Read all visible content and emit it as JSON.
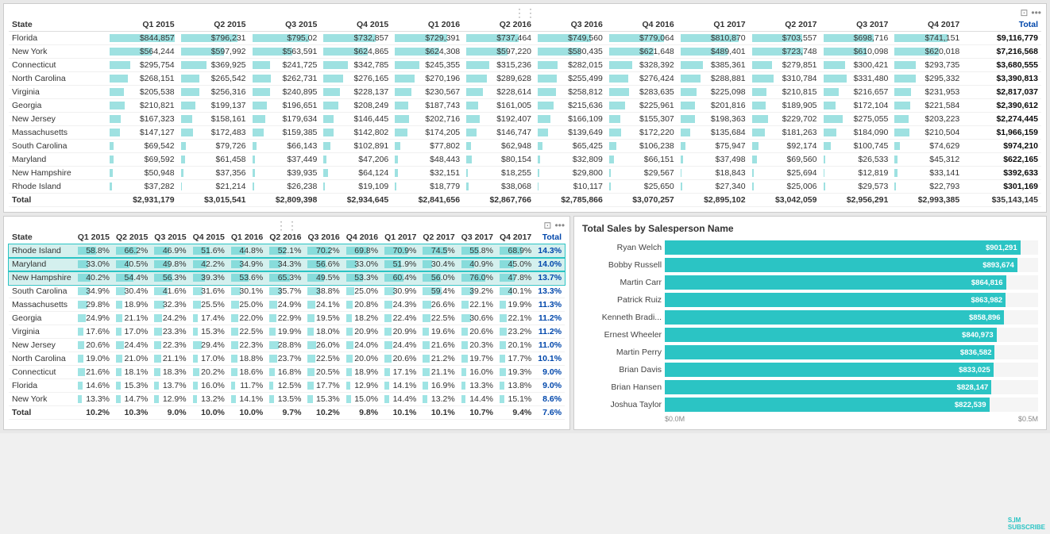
{
  "topTable": {
    "title": "State",
    "columns": [
      "State",
      "Q1 2015",
      "Q2 2015",
      "Q3 2015",
      "Q4 2015",
      "Q1 2016",
      "Q2 2016",
      "Q3 2016",
      "Q4 2016",
      "Q1 2017",
      "Q2 2017",
      "Q3 2017",
      "Q4 2017",
      "Total"
    ],
    "rows": [
      [
        "Florida",
        "$844,857",
        "$796,231",
        "$795,02",
        "$732,857",
        "$729,391",
        "$737,464",
        "$749,560",
        "$779,064",
        "$810,870",
        "$703,557",
        "$698,716",
        "$741,151",
        "$9,116,779"
      ],
      [
        "New York",
        "$564,244",
        "$597,992",
        "$563,591",
        "$624,865",
        "$624,308",
        "$597,220",
        "$580,435",
        "$621,648",
        "$489,401",
        "$723,748",
        "$610,098",
        "$620,018",
        "$7,216,568"
      ],
      [
        "Connecticut",
        "$295,754",
        "$369,925",
        "$241,725",
        "$342,785",
        "$245,355",
        "$315,236",
        "$282,015",
        "$328,392",
        "$385,361",
        "$279,851",
        "$300,421",
        "$293,735",
        "$3,680,555"
      ],
      [
        "North Carolina",
        "$268,151",
        "$265,542",
        "$262,731",
        "$276,165",
        "$270,196",
        "$289,628",
        "$255,499",
        "$276,424",
        "$288,881",
        "$310,784",
        "$331,480",
        "$295,332",
        "$3,390,813"
      ],
      [
        "Virginia",
        "$205,538",
        "$256,316",
        "$240,895",
        "$228,137",
        "$230,567",
        "$228,614",
        "$258,812",
        "$283,635",
        "$225,098",
        "$210,815",
        "$216,657",
        "$231,953",
        "$2,817,037"
      ],
      [
        "Georgia",
        "$210,821",
        "$199,137",
        "$196,651",
        "$208,249",
        "$187,743",
        "$161,005",
        "$215,636",
        "$225,961",
        "$201,816",
        "$189,905",
        "$172,104",
        "$221,584",
        "$2,390,612"
      ],
      [
        "New Jersey",
        "$167,323",
        "$158,161",
        "$179,634",
        "$146,445",
        "$202,716",
        "$192,407",
        "$166,109",
        "$155,307",
        "$198,363",
        "$229,702",
        "$275,055",
        "$203,223",
        "$2,274,445"
      ],
      [
        "Massachusetts",
        "$147,127",
        "$172,483",
        "$159,385",
        "$142,802",
        "$174,205",
        "$146,747",
        "$139,649",
        "$172,220",
        "$135,684",
        "$181,263",
        "$184,090",
        "$210,504",
        "$1,966,159"
      ],
      [
        "South Carolina",
        "$69,542",
        "$79,726",
        "$66,143",
        "$102,891",
        "$77,802",
        "$62,948",
        "$65,425",
        "$106,238",
        "$75,947",
        "$92,174",
        "$100,745",
        "$74,629",
        "$974,210"
      ],
      [
        "Maryland",
        "$69,592",
        "$61,458",
        "$37,449",
        "$47,206",
        "$48,443",
        "$80,154",
        "$32,809",
        "$66,151",
        "$37,498",
        "$69,560",
        "$26,533",
        "$45,312",
        "$622,165"
      ],
      [
        "New Hampshire",
        "$50,948",
        "$37,356",
        "$39,935",
        "$64,124",
        "$32,151",
        "$18,255",
        "$29,800",
        "$29,567",
        "$18,843",
        "$25,694",
        "$12,819",
        "$33,141",
        "$392,633"
      ],
      [
        "Rhode Island",
        "$37,282",
        "$21,214",
        "$26,238",
        "$19,109",
        "$18,779",
        "$38,068",
        "$10,117",
        "$25,650",
        "$27,340",
        "$25,006",
        "$29,573",
        "$22,793",
        "$301,169"
      ],
      [
        "Total",
        "$2,931,179",
        "$3,015,541",
        "$2,809,398",
        "$2,934,645",
        "$2,841,656",
        "$2,867,766",
        "$2,785,866",
        "$3,070,257",
        "$2,895,102",
        "$3,042,059",
        "$2,956,291",
        "$2,993,385",
        "$35,143,145"
      ]
    ],
    "barWidths": [
      100,
      87,
      87,
      80,
      80,
      81,
      82,
      85,
      89,
      77,
      77,
      81,
      0,
      65,
      66,
      62,
      68,
      68,
      63,
      66,
      68,
      72,
      79,
      67,
      68,
      0,
      32,
      40,
      27,
      38,
      27,
      35,
      31,
      36,
      27,
      31,
      33,
      32,
      0,
      29,
      28,
      29,
      30,
      30,
      32,
      29,
      30,
      28,
      34,
      36,
      32,
      0,
      22,
      28,
      27,
      25,
      25,
      25,
      28,
      31,
      25,
      23,
      24,
      25,
      0,
      23,
      22,
      13,
      17,
      17,
      21,
      9,
      22,
      14,
      21,
      10,
      17,
      0,
      18,
      15,
      14,
      15,
      19,
      18,
      15,
      16,
      12,
      17,
      17,
      15,
      0,
      7,
      8,
      7,
      11,
      8,
      7,
      7,
      11,
      8,
      10,
      11,
      8,
      0,
      7,
      6,
      4,
      5,
      5,
      9,
      4,
      7,
      4,
      8,
      3,
      5,
      0,
      5,
      4,
      4,
      7,
      4,
      2,
      3,
      3,
      2,
      3,
      1,
      4,
      0,
      4,
      2,
      3,
      2,
      2,
      4,
      1,
      3,
      3,
      3,
      3,
      2,
      0
    ]
  },
  "bottomTable": {
    "columns": [
      "State",
      "Q1 2015",
      "Q2 2015",
      "Q3 2015",
      "Q4 2015",
      "Q1 2016",
      "Q2 2016",
      "Q3 2016",
      "Q4 2016",
      "Q1 2017",
      "Q2 2017",
      "Q3 2017",
      "Q4 2017",
      "Total"
    ],
    "rows": [
      [
        "Rhode Island",
        "58.8%",
        "66.2%",
        "46.9%",
        "51.6%",
        "44.8%",
        "52.1%",
        "70.2%",
        "69.8%",
        "70.9%",
        "74.5%",
        "55.8%",
        "68.9%",
        "14.3%",
        true
      ],
      [
        "Maryland",
        "33.0%",
        "40.5%",
        "49.8%",
        "42.2%",
        "34.9%",
        "34.3%",
        "56.6%",
        "33.0%",
        "51.9%",
        "30.4%",
        "40.9%",
        "45.0%",
        "14.0%",
        true
      ],
      [
        "New Hampshire",
        "40.2%",
        "54.4%",
        "56.3%",
        "39.3%",
        "53.6%",
        "65.3%",
        "49.5%",
        "53.3%",
        "60.4%",
        "56.0%",
        "76.0%",
        "47.8%",
        "13.7%",
        true
      ],
      [
        "South Carolina",
        "34.9%",
        "30.4%",
        "41.6%",
        "31.6%",
        "30.1%",
        "35.7%",
        "38.8%",
        "25.0%",
        "30.9%",
        "59.4%",
        "39.2%",
        "40.1%",
        "13.3%",
        false
      ],
      [
        "Massachusetts",
        "29.8%",
        "18.9%",
        "32.3%",
        "25.5%",
        "25.0%",
        "24.9%",
        "24.1%",
        "20.8%",
        "24.3%",
        "26.6%",
        "22.1%",
        "19.9%",
        "11.3%",
        false
      ],
      [
        "Georgia",
        "24.9%",
        "21.1%",
        "24.2%",
        "17.4%",
        "22.0%",
        "22.9%",
        "19.5%",
        "18.2%",
        "22.4%",
        "22.5%",
        "30.6%",
        "22.1%",
        "11.2%",
        false
      ],
      [
        "Virginia",
        "17.6%",
        "17.0%",
        "23.3%",
        "15.3%",
        "22.5%",
        "19.9%",
        "18.0%",
        "20.9%",
        "20.9%",
        "19.6%",
        "20.6%",
        "23.2%",
        "11.2%",
        false
      ],
      [
        "New Jersey",
        "20.6%",
        "24.4%",
        "22.3%",
        "29.4%",
        "22.3%",
        "28.8%",
        "26.0%",
        "24.0%",
        "24.4%",
        "21.6%",
        "20.3%",
        "20.1%",
        "11.0%",
        false
      ],
      [
        "North Carolina",
        "19.0%",
        "21.0%",
        "21.1%",
        "17.0%",
        "18.8%",
        "23.7%",
        "22.5%",
        "20.0%",
        "20.6%",
        "21.2%",
        "19.7%",
        "17.7%",
        "10.1%",
        false
      ],
      [
        "Connecticut",
        "21.6%",
        "18.1%",
        "18.3%",
        "20.2%",
        "18.6%",
        "16.8%",
        "20.5%",
        "18.9%",
        "17.1%",
        "21.1%",
        "16.0%",
        "19.3%",
        "9.0%",
        false
      ],
      [
        "Florida",
        "14.6%",
        "15.3%",
        "13.7%",
        "16.0%",
        "11.7%",
        "12.5%",
        "17.7%",
        "12.9%",
        "14.1%",
        "16.9%",
        "13.3%",
        "13.8%",
        "9.0%",
        false
      ],
      [
        "New York",
        "13.3%",
        "14.7%",
        "12.9%",
        "13.2%",
        "14.1%",
        "13.5%",
        "15.3%",
        "15.0%",
        "14.4%",
        "13.2%",
        "14.4%",
        "15.1%",
        "8.6%",
        false
      ],
      [
        "Total",
        "10.2%",
        "10.3%",
        "9.0%",
        "10.0%",
        "10.0%",
        "9.7%",
        "10.2%",
        "9.8%",
        "10.1%",
        "10.1%",
        "10.7%",
        "9.4%",
        "7.6%",
        false
      ]
    ]
  },
  "barChart": {
    "title": "Total Sales by Salesperson Name",
    "maxVal": 901291,
    "people": [
      {
        "name": "Ryan Welch",
        "value": 901291,
        "label": "$901,291"
      },
      {
        "name": "Bobby Russell",
        "value": 893674,
        "label": "$893,674"
      },
      {
        "name": "Martin Carr",
        "value": 864816,
        "label": "$864,816"
      },
      {
        "name": "Patrick Ruiz",
        "value": 863982,
        "label": "$863,982"
      },
      {
        "name": "Kenneth Bradi...",
        "value": 858896,
        "label": "$858,896"
      },
      {
        "name": "Ernest Wheeler",
        "value": 840973,
        "label": "$840,973"
      },
      {
        "name": "Martin Perry",
        "value": 836582,
        "label": "$836,582"
      },
      {
        "name": "Brian Davis",
        "value": 833025,
        "label": "$833,025"
      },
      {
        "name": "Brian Hansen",
        "value": 828147,
        "label": "$828,147"
      },
      {
        "name": "Joshua Taylor",
        "value": 822539,
        "label": "$822,539"
      }
    ],
    "axisLabels": [
      "$0.0M",
      "$0.5M"
    ]
  },
  "ui": {
    "dragHandle": "⋮⋮",
    "panelIcon1": "⊡",
    "panelIcon2": "•••",
    "watermark": "S⅃M\nSUBSCRIBE"
  }
}
